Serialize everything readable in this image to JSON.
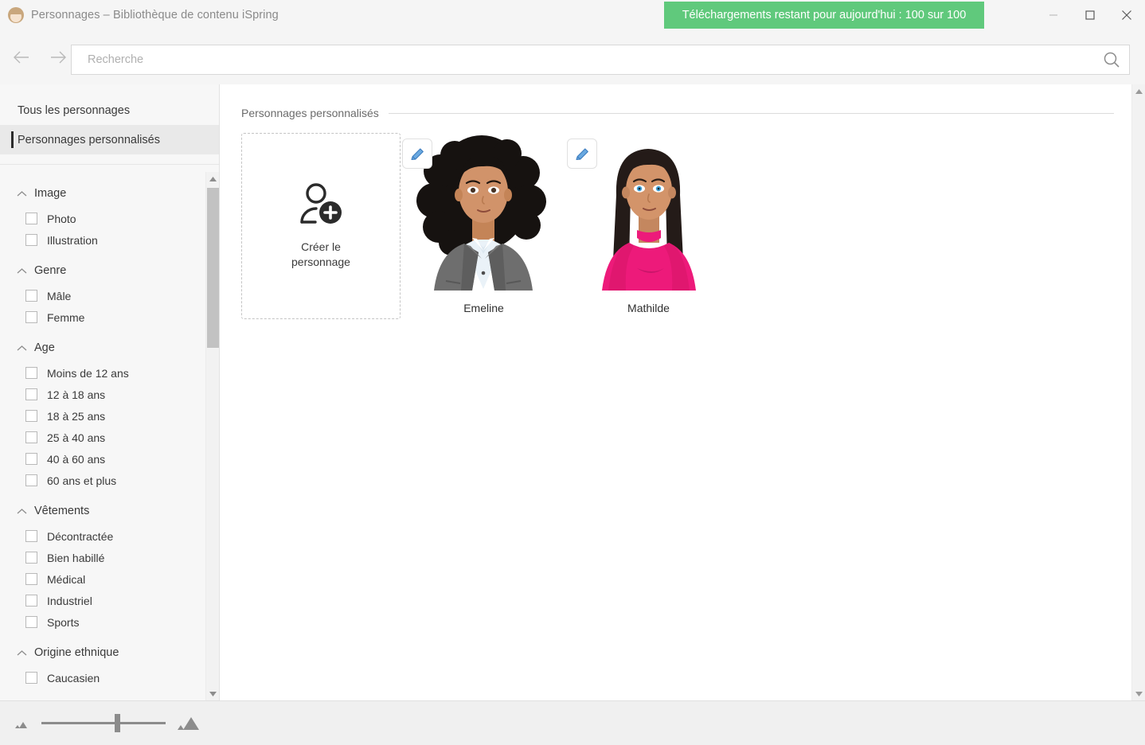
{
  "window": {
    "title": "Personnages – Bibliothèque de contenu iSpring",
    "app_icon": "person-avatar-icon",
    "notification": "Téléchargements restant pour aujourd'hui : 100 sur 100",
    "notification_color": "#60c97c",
    "controls": {
      "minimize": "minimize-icon",
      "maximize": "maximize-icon",
      "close": "close-icon"
    }
  },
  "toolbar": {
    "back_icon": "arrow-left-icon",
    "forward_icon": "arrow-right-icon",
    "search_placeholder": "Recherche",
    "search_value": "",
    "search_icon": "search-icon"
  },
  "sidebar": {
    "nav": [
      {
        "label": "Tous les personnages",
        "active": false
      },
      {
        "label": "Personnages personnalisés",
        "active": true
      }
    ],
    "filter_groups": [
      {
        "title": "Image",
        "items": [
          {
            "label": "Photo",
            "checked": false
          },
          {
            "label": "Illustration",
            "checked": false
          }
        ]
      },
      {
        "title": "Genre",
        "items": [
          {
            "label": "Mâle",
            "checked": false
          },
          {
            "label": "Femme",
            "checked": false
          }
        ]
      },
      {
        "title": "Age",
        "items": [
          {
            "label": "Moins de 12 ans",
            "checked": false
          },
          {
            "label": "12 à 18 ans",
            "checked": false
          },
          {
            "label": "18 à 25 ans",
            "checked": false
          },
          {
            "label": "25 à 40 ans",
            "checked": false
          },
          {
            "label": "40 à 60 ans",
            "checked": false
          },
          {
            "label": "60 ans et plus",
            "checked": false
          }
        ]
      },
      {
        "title": "Vêtements",
        "items": [
          {
            "label": "Décontractée",
            "checked": false
          },
          {
            "label": "Bien habillé",
            "checked": false
          },
          {
            "label": "Médical",
            "checked": false
          },
          {
            "label": "Industriel",
            "checked": false
          },
          {
            "label": "Sports",
            "checked": false
          }
        ]
      },
      {
        "title": "Origine ethnique",
        "items": [
          {
            "label": "Caucasien",
            "checked": false
          }
        ]
      }
    ],
    "scrollbar": {
      "up_icon": "scroll-up-arrow-icon",
      "down_icon": "scroll-down-arrow-icon"
    }
  },
  "main": {
    "section_title": "Personnages personnalisés",
    "create_card": {
      "icon": "add-person-icon",
      "label": "Créer le\npersonnage",
      "label_line1": "Créer le",
      "label_line2": "personnage"
    },
    "characters": [
      {
        "name": "Emeline",
        "edit_icon": "pencil-edit-icon",
        "hair_color": "#1b1b1b",
        "skin_color": "#cf9368",
        "outfit_color": "#6e6e6e",
        "shirt_color": "#eaf2f8"
      },
      {
        "name": "Mathilde",
        "edit_icon": "pencil-edit-icon",
        "hair_color": "#2a1f1c",
        "skin_color": "#d3946a",
        "outfit_color": "#ed1a7a",
        "shirt_color": "#ed1a7a"
      }
    ],
    "scrollbar": {
      "up_icon": "scroll-up-arrow-icon",
      "down_icon": "scroll-down-arrow-icon"
    }
  },
  "bottom": {
    "zoom_small_icon": "zoom-small-thumbnail-icon",
    "zoom_large_icon": "zoom-large-thumbnail-icon",
    "zoom_value": 58
  }
}
